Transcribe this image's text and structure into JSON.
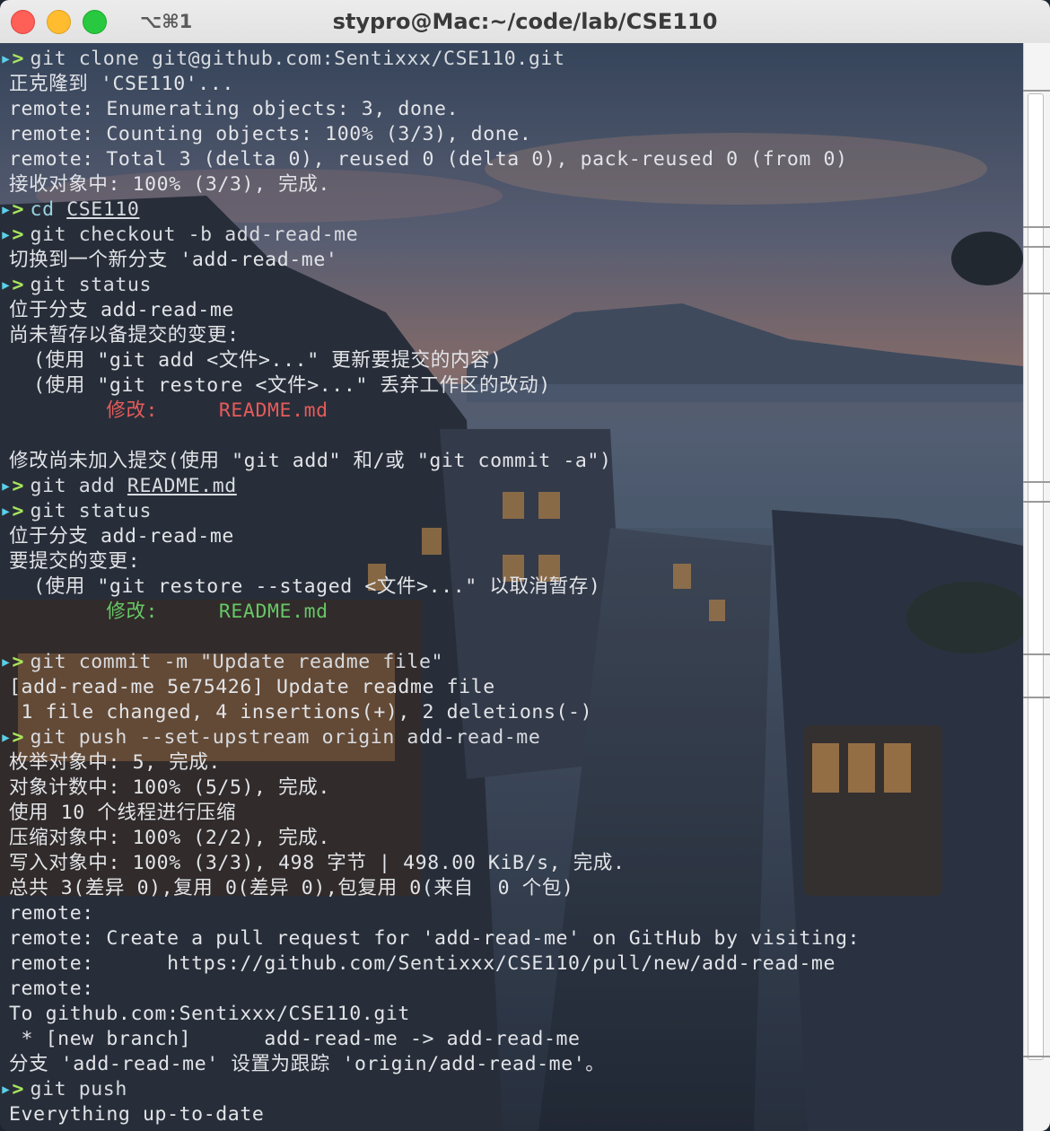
{
  "window": {
    "shortcut": "⌥⌘1",
    "title": "stypro@Mac:~/code/lab/CSE110"
  },
  "colors": {
    "prompt": "#5ad0e8",
    "modified_red": "#e55b5b",
    "staged_green": "#66c766",
    "text": "#e2e4e8"
  },
  "terminal": {
    "lines": [
      {
        "type": "prompt",
        "cmd": "git clone git@github.com:Sentixxx/CSE110.git"
      },
      {
        "type": "out",
        "text": "正克隆到 'CSE110'..."
      },
      {
        "type": "out",
        "text": "remote: Enumerating objects: 3, done."
      },
      {
        "type": "out",
        "text": "remote: Counting objects: 100% (3/3), done."
      },
      {
        "type": "out",
        "text": "remote: Total 3 (delta 0), reused 0 (delta 0), pack-reused 0 (from 0)"
      },
      {
        "type": "out",
        "text": "接收对象中: 100% (3/3), 完成."
      },
      {
        "type": "prompt",
        "cmd": "cd ",
        "arg": "CSE110",
        "argUnderline": true,
        "cdStyle": true
      },
      {
        "type": "prompt",
        "cmd": "git checkout -b add-read-me"
      },
      {
        "type": "out",
        "text": "切换到一个新分支 'add-read-me'"
      },
      {
        "type": "prompt",
        "cmd": "git status"
      },
      {
        "type": "out",
        "text": "位于分支 add-read-me"
      },
      {
        "type": "out",
        "text": "尚未暂存以备提交的变更:"
      },
      {
        "type": "out",
        "text": "  (使用 \"git add <文件>...\" 更新要提交的内容)"
      },
      {
        "type": "out",
        "text": "  (使用 \"git restore <文件>...\" 丢弃工作区的改动)"
      },
      {
        "type": "colored",
        "cls": "red",
        "text": "\t修改:     README.md"
      },
      {
        "type": "out",
        "text": ""
      },
      {
        "type": "out",
        "text": "修改尚未加入提交(使用 \"git add\" 和/或 \"git commit -a\")"
      },
      {
        "type": "prompt",
        "cmd": "git add ",
        "arg": "README.md",
        "argUnderline": true
      },
      {
        "type": "prompt",
        "cmd": "git status"
      },
      {
        "type": "out",
        "text": "位于分支 add-read-me"
      },
      {
        "type": "out",
        "text": "要提交的变更:"
      },
      {
        "type": "out",
        "text": "  (使用 \"git restore --staged <文件>...\" 以取消暂存)"
      },
      {
        "type": "colored",
        "cls": "green",
        "text": "\t修改:     README.md"
      },
      {
        "type": "out",
        "text": ""
      },
      {
        "type": "prompt",
        "cmd": "git commit -m \"Update readme file\""
      },
      {
        "type": "out",
        "text": "[add-read-me 5e75426] Update readme file"
      },
      {
        "type": "out",
        "text": " 1 file changed, 4 insertions(+), 2 deletions(-)"
      },
      {
        "type": "prompt",
        "cmd": "git push --set-upstream origin add-read-me"
      },
      {
        "type": "out",
        "text": "枚举对象中: 5, 完成."
      },
      {
        "type": "out",
        "text": "对象计数中: 100% (5/5), 完成."
      },
      {
        "type": "out",
        "text": "使用 10 个线程进行压缩"
      },
      {
        "type": "out",
        "text": "压缩对象中: 100% (2/2), 完成."
      },
      {
        "type": "out",
        "text": "写入对象中: 100% (3/3), 498 字节 | 498.00 KiB/s, 完成."
      },
      {
        "type": "out",
        "text": "总共 3(差异 0),复用 0(差异 0),包复用 0(来自  0 个包)"
      },
      {
        "type": "out",
        "text": "remote:"
      },
      {
        "type": "out",
        "text": "remote: Create a pull request for 'add-read-me' on GitHub by visiting:"
      },
      {
        "type": "out",
        "text": "remote:      https://github.com/Sentixxx/CSE110/pull/new/add-read-me"
      },
      {
        "type": "out",
        "text": "remote:"
      },
      {
        "type": "out",
        "text": "To github.com:Sentixxx/CSE110.git"
      },
      {
        "type": "out",
        "text": " * [new branch]      add-read-me -> add-read-me"
      },
      {
        "type": "out",
        "text": "分支 'add-read-me' 设置为跟踪 'origin/add-read-me'。"
      },
      {
        "type": "prompt",
        "cmd": "git push"
      },
      {
        "type": "out",
        "text": "Everything up-to-date"
      }
    ]
  }
}
